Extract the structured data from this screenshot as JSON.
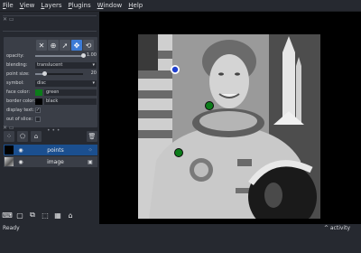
{
  "menu": {
    "items": [
      {
        "mnemonic": "F",
        "rest": "ile"
      },
      {
        "mnemonic": "V",
        "rest": "iew"
      },
      {
        "mnemonic": "L",
        "rest": "ayers"
      },
      {
        "mnemonic": "P",
        "rest": "lugins"
      },
      {
        "mnemonic": "W",
        "rest": "indow"
      },
      {
        "mnemonic": "H",
        "rest": "elp"
      }
    ]
  },
  "layer_controls": {
    "tools": [
      {
        "icon": "close-icon",
        "glyph": "✕"
      },
      {
        "icon": "add-point-icon",
        "glyph": "⊕"
      },
      {
        "icon": "select-arrow-icon",
        "glyph": "➚"
      },
      {
        "icon": "pan-zoom-icon",
        "glyph": "✥"
      },
      {
        "icon": "transform-icon",
        "glyph": "⟲"
      }
    ],
    "opacity": {
      "label": "opacity:",
      "value": "1.00",
      "fraction": 1.0
    },
    "blending": {
      "label": "blending:",
      "value": "translucent"
    },
    "point_size": {
      "label": "point size:",
      "value": "20",
      "fraction": 0.2
    },
    "symbol": {
      "label": "symbol:",
      "value": "disc"
    },
    "face_color": {
      "label": "face color:",
      "value": "green",
      "swatch": "#0c7c1a"
    },
    "border_color": {
      "label": "border color:",
      "value": "black",
      "swatch": "#000000"
    },
    "display_text": {
      "label": "display text:",
      "checked": true
    },
    "out_of_slice": {
      "label": "out of slice:",
      "checked": false
    }
  },
  "layers": [
    {
      "name": "points",
      "type_icon": "points-layer-icon",
      "selected": true,
      "visible": true
    },
    {
      "name": "image",
      "type_icon": "image-layer-icon",
      "selected": false,
      "visible": true
    }
  ],
  "status": {
    "text": "Ready",
    "activity": "^ activity"
  },
  "colors": {
    "background": "#262930",
    "panel": "#3a3e47",
    "selected": "#1b4f8f",
    "accent": "#3c7bd6"
  }
}
